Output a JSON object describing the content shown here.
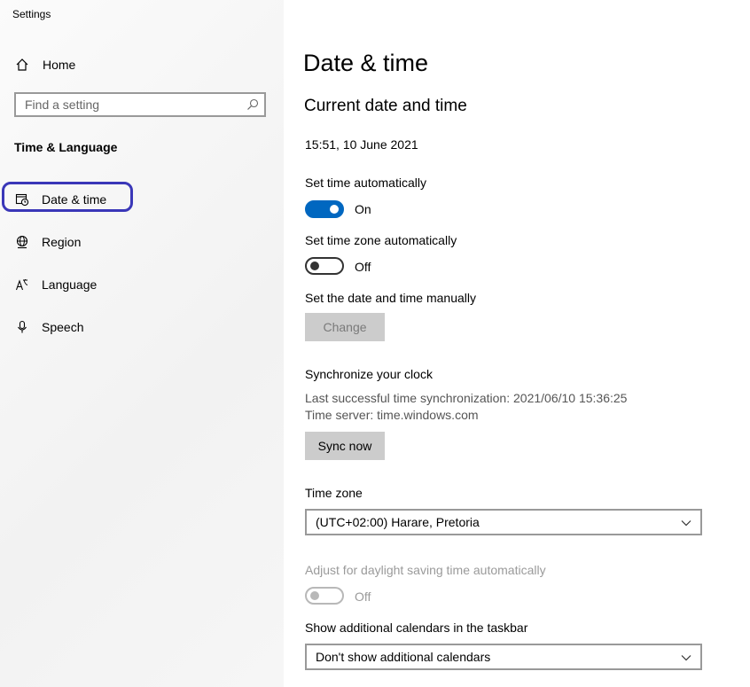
{
  "window": {
    "title": "Settings"
  },
  "sidebar": {
    "home_label": "Home",
    "search_placeholder": "Find a setting",
    "section_label": "Time & Language",
    "items": [
      {
        "label": "Date & time",
        "icon": "calendar-clock-icon",
        "selected": true
      },
      {
        "label": "Region",
        "icon": "globe-icon"
      },
      {
        "label": "Language",
        "icon": "language-icon"
      },
      {
        "label": "Speech",
        "icon": "microphone-icon"
      }
    ]
  },
  "main": {
    "title": "Date & time",
    "current_heading": "Current date and time",
    "current_value": "15:51, 10 June 2021",
    "set_time_auto": {
      "label": "Set time automatically",
      "state": "On"
    },
    "set_zone_auto": {
      "label": "Set time zone automatically",
      "state": "Off"
    },
    "manual": {
      "label": "Set the date and time manually",
      "button": "Change"
    },
    "sync": {
      "heading": "Synchronize your clock",
      "last": "Last successful time synchronization: 2021/06/10 15:36:25",
      "server": "Time server: time.windows.com",
      "button": "Sync now"
    },
    "timezone": {
      "label": "Time zone",
      "value": "(UTC+02:00) Harare, Pretoria"
    },
    "dst": {
      "label": "Adjust for daylight saving time automatically",
      "state": "Off"
    },
    "calendars": {
      "label": "Show additional calendars in the taskbar",
      "value": "Don't show additional calendars"
    }
  },
  "colors": {
    "accent": "#0067c0",
    "highlight_outline": "#3a37b8",
    "button_bg": "#cccccc"
  }
}
